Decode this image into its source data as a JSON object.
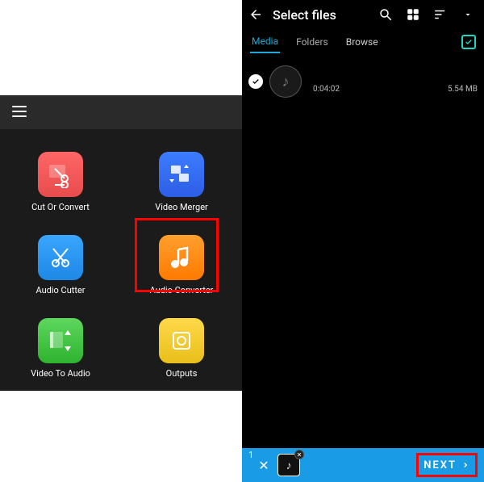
{
  "left": {
    "tools": [
      {
        "label": "Cut Or Convert",
        "icon": "scissors-film-icon",
        "tileClass": "tile-red"
      },
      {
        "label": "Video Merger",
        "icon": "merge-icon",
        "tileClass": "tile-darkblue"
      },
      {
        "label": "Audio Cutter",
        "icon": "scissors-icon",
        "tileClass": "tile-blue"
      },
      {
        "label": "Audio Converter",
        "icon": "music-note-icon",
        "tileClass": "tile-orange"
      },
      {
        "label": "Video To Audio",
        "icon": "film-to-audio-icon",
        "tileClass": "tile-green"
      },
      {
        "label": "Outputs",
        "icon": "output-icon",
        "tileClass": "tile-yellow"
      }
    ]
  },
  "right": {
    "title": "Select files",
    "tabs": {
      "media": "Media",
      "folders": "Folders",
      "browse": "Browse"
    },
    "file": {
      "duration": "0:04:02",
      "size": "5.54 MB"
    },
    "bottom": {
      "count": "1",
      "next": "NEXT"
    }
  }
}
